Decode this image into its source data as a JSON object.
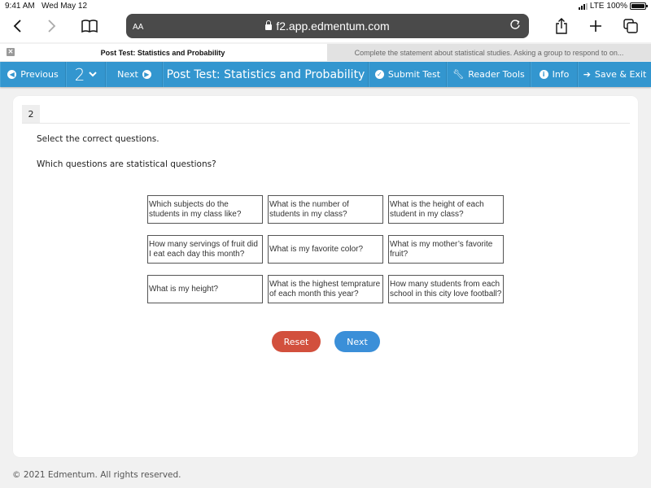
{
  "status_bar": {
    "time": "9:41 AM",
    "date": "Wed May 12",
    "network": "LTE",
    "battery": "100%",
    "battery_level": 1.0
  },
  "browser": {
    "text_size_label": "AA",
    "url": "f2.app.edmentum.com",
    "icons": {
      "back": "chevron-left-icon",
      "forward": "chevron-right-icon",
      "bookmarks": "book-icon",
      "lock": "lock-icon",
      "reload": "reload-icon",
      "share": "share-icon",
      "new_tab": "plus-icon",
      "tabs": "tabs-icon"
    },
    "tabs": [
      {
        "label": "Post Test: Statistics and Probability",
        "active": true
      },
      {
        "label": "Complete the statement about statistical studies. Asking a group to respond to on...",
        "active": false
      }
    ]
  },
  "navbar": {
    "previous": "Previous",
    "question_number": "2",
    "next": "Next",
    "title": "Post Test: Statistics and Probability",
    "submit": "Submit Test",
    "reader_tools": "Reader Tools",
    "info": "Info",
    "save_exit": "Save & Exit",
    "accent_color": "#3396cf"
  },
  "question": {
    "number": "2",
    "instruction": "Select the correct questions.",
    "prompt": "Which questions are statistical questions?",
    "options": [
      "Which subjects do the students in my class like?",
      "What is the number of students in my class?",
      "What is the height of each student in my class?",
      "How many servings of fruit did I eat each day this month?",
      "What is my favorite color?",
      "What is my mother’s favorite fruit?",
      "What is my height?",
      "What is the highest temprature of each month this year?",
      "How many students from each school in this city love football?"
    ],
    "reset_label": "Reset",
    "next_label": "Next",
    "reset_color": "#d2503d",
    "next_color": "#3b8fd8"
  },
  "footer": {
    "copyright": "© 2021 Edmentum. All rights reserved."
  }
}
